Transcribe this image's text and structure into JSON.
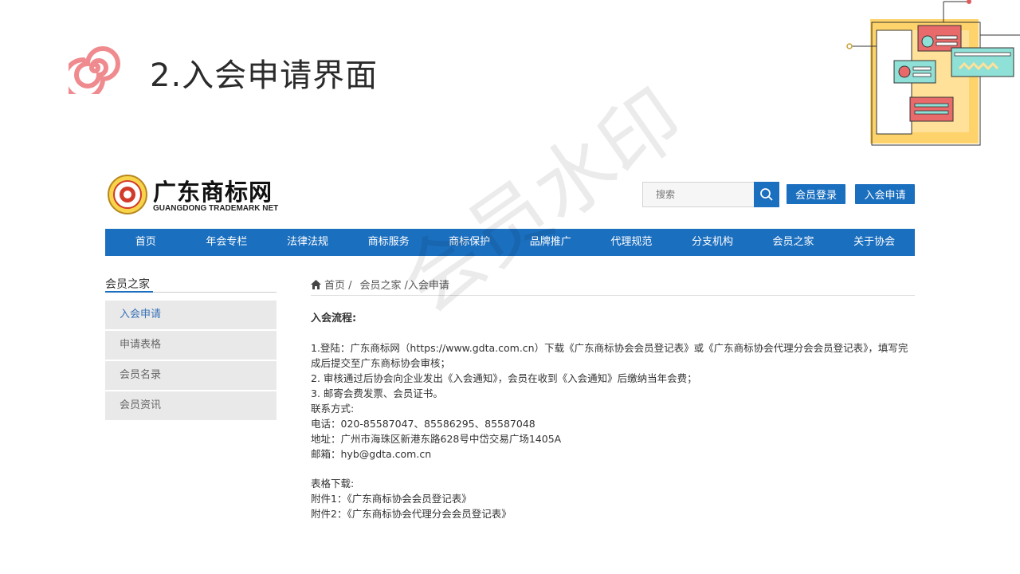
{
  "slide": {
    "title": "2.入会申请界面"
  },
  "site": {
    "brand_cn": "广东商标网",
    "brand_en": "GUANGDONG TRADEMARK NET",
    "search_placeholder": "搜索",
    "login_label": "会员登录",
    "join_label": "入会申请",
    "nav": [
      "首页",
      "年会专栏",
      "法律法规",
      "商标服务",
      "商标保护",
      "品牌推广",
      "代理规范",
      "分支机构",
      "会员之家",
      "关于协会"
    ],
    "sidebar": {
      "title": "会员之家",
      "items": [
        "入会申请",
        "申请表格",
        "会员名录",
        "会员资讯"
      ]
    },
    "breadcrumb": {
      "home": "首页 /",
      "section": "会员之家",
      "current": "/入会申请"
    },
    "content": {
      "heading": "入会流程:",
      "steps": [
        "1.登陆：广东商标网（https://www.gdta.com.cn）下载《广东商标协会会员登记表》或《广东商标协会代理分会会员登记表》，填写完成后提交至广东商标协会审核；",
        "2. 审核通过后协会向企业发出《入会通知》，会员在收到《入会通知》后缴纳当年会费；",
        "3. 邮寄会费发票、会员证书。"
      ],
      "contact_label": "联系方式:",
      "phone": "电话：020-85587047、85586295、85587048",
      "address": "地址：广州市海珠区新港东路628号中岱交易广场1405A",
      "email": "邮箱：hyb@gdta.com.cn",
      "downloads_label": "表格下载:",
      "attachment1": "附件1：《广东商标协会会员登记表》",
      "attachment2": "附件2：《广东商标协会代理分会会员登记表》"
    },
    "watermark": "会员水印"
  },
  "colors": {
    "primary": "#1b6fbf",
    "spiral": "#ef8b8f",
    "sidebar_bg": "#e9e9e9"
  }
}
